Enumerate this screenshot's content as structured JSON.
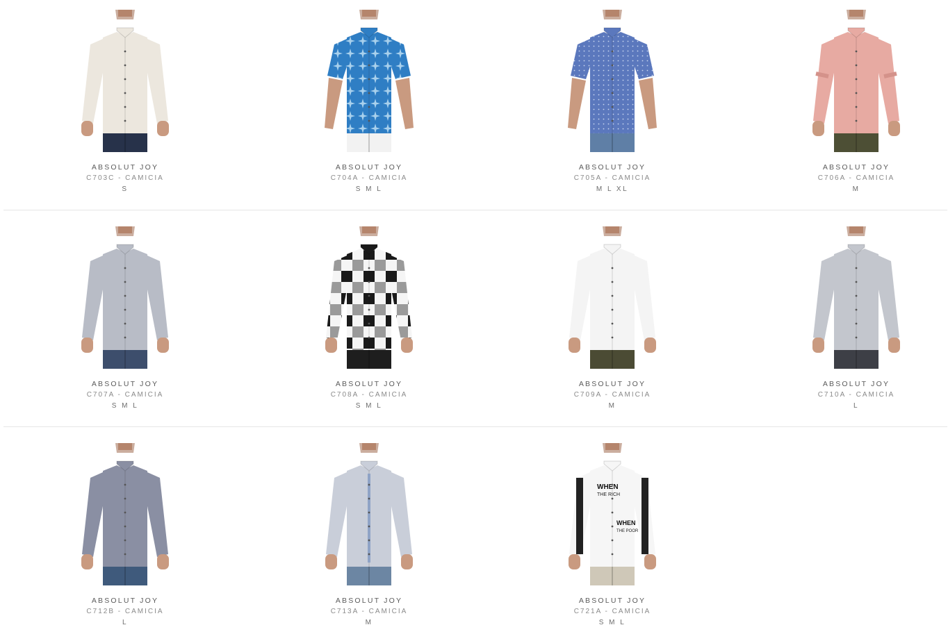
{
  "colors": {
    "background": "#ffffff",
    "divider": "#e6e6e6",
    "brand_text": "#5a5a5a",
    "code_text": "#8a8a8a",
    "sizes_text": "#6d6d6d"
  },
  "products": [
    {
      "brand": "ABSOLUT JOY",
      "code": "C703C - CAMICIA",
      "sizes": "S",
      "image": "shirt-photo-beige-linen-long-sleeve",
      "shirt_color": "#ece7de",
      "pattern": "none",
      "pants_color": "#27324a",
      "sleeve": "long"
    },
    {
      "brand": "ABSOLUT JOY",
      "code": "C704A - CAMICIA",
      "sizes": "S M L",
      "image": "shirt-photo-blue-floral-short-sleeve",
      "shirt_color": "#2f7ec4",
      "pattern": "floral",
      "pants_color": "#f2f2f2",
      "sleeve": "short"
    },
    {
      "brand": "ABSOLUT JOY",
      "code": "C705A - CAMICIA",
      "sizes": "M L XL",
      "image": "shirt-photo-blue-dotted-short-sleeve",
      "shirt_color": "#5b78bd",
      "pattern": "dots",
      "pants_color": "#5f7fa6",
      "sleeve": "short"
    },
    {
      "brand": "ABSOLUT JOY",
      "code": "C706A - CAMICIA",
      "sizes": "M",
      "image": "shirt-photo-pink-mandarin-collar",
      "shirt_color": "#e7aaa2",
      "pattern": "none",
      "pants_color": "#4d4f35",
      "sleeve": "rolled"
    },
    {
      "brand": "ABSOLUT JOY",
      "code": "C707A - CAMICIA",
      "sizes": "S M L",
      "image": "shirt-photo-grey-long-sleeve",
      "shirt_color": "#b8bcc6",
      "pattern": "none",
      "pants_color": "#3d4e6c",
      "sleeve": "long"
    },
    {
      "brand": "ABSOLUT JOY",
      "code": "C708A - CAMICIA",
      "sizes": "S M L",
      "image": "shirt-photo-black-white-check",
      "shirt_color": "#f5f5f5",
      "pattern": "check",
      "pants_color": "#1e1e1e",
      "sleeve": "long"
    },
    {
      "brand": "ABSOLUT JOY",
      "code": "C709A - CAMICIA",
      "sizes": "M",
      "image": "shirt-photo-white-mandarin-collar",
      "shirt_color": "#f4f4f4",
      "pattern": "none",
      "pants_color": "#4b4b34",
      "sleeve": "long"
    },
    {
      "brand": "ABSOLUT JOY",
      "code": "C710A - CAMICIA",
      "sizes": "L",
      "image": "shirt-photo-light-grey-mandarin-collar",
      "shirt_color": "#c3c6cd",
      "pattern": "none",
      "pants_color": "#3d3f46",
      "sleeve": "long"
    },
    {
      "brand": "ABSOLUT JOY",
      "code": "C712B - CAMICIA",
      "sizes": "L",
      "image": "shirt-photo-slate-grey-long-sleeve",
      "shirt_color": "#8a8fa3",
      "pattern": "none",
      "pants_color": "#3f5a7c",
      "sleeve": "long"
    },
    {
      "brand": "ABSOLUT JOY",
      "code": "C713A - CAMICIA",
      "sizes": "M",
      "image": "shirt-photo-light-blue-grey-long-sleeve",
      "shirt_color": "#c9ced9",
      "pattern": "placket",
      "pants_color": "#6c86a3",
      "sleeve": "long"
    },
    {
      "brand": "ABSOLUT JOY",
      "code": "C721A - CAMICIA",
      "sizes": "S M L",
      "image": "shirt-photo-white-print-graphic",
      "shirt_color": "#f6f6f6",
      "pattern": "print",
      "pants_color": "#cfc8b8",
      "sleeve": "long"
    }
  ]
}
